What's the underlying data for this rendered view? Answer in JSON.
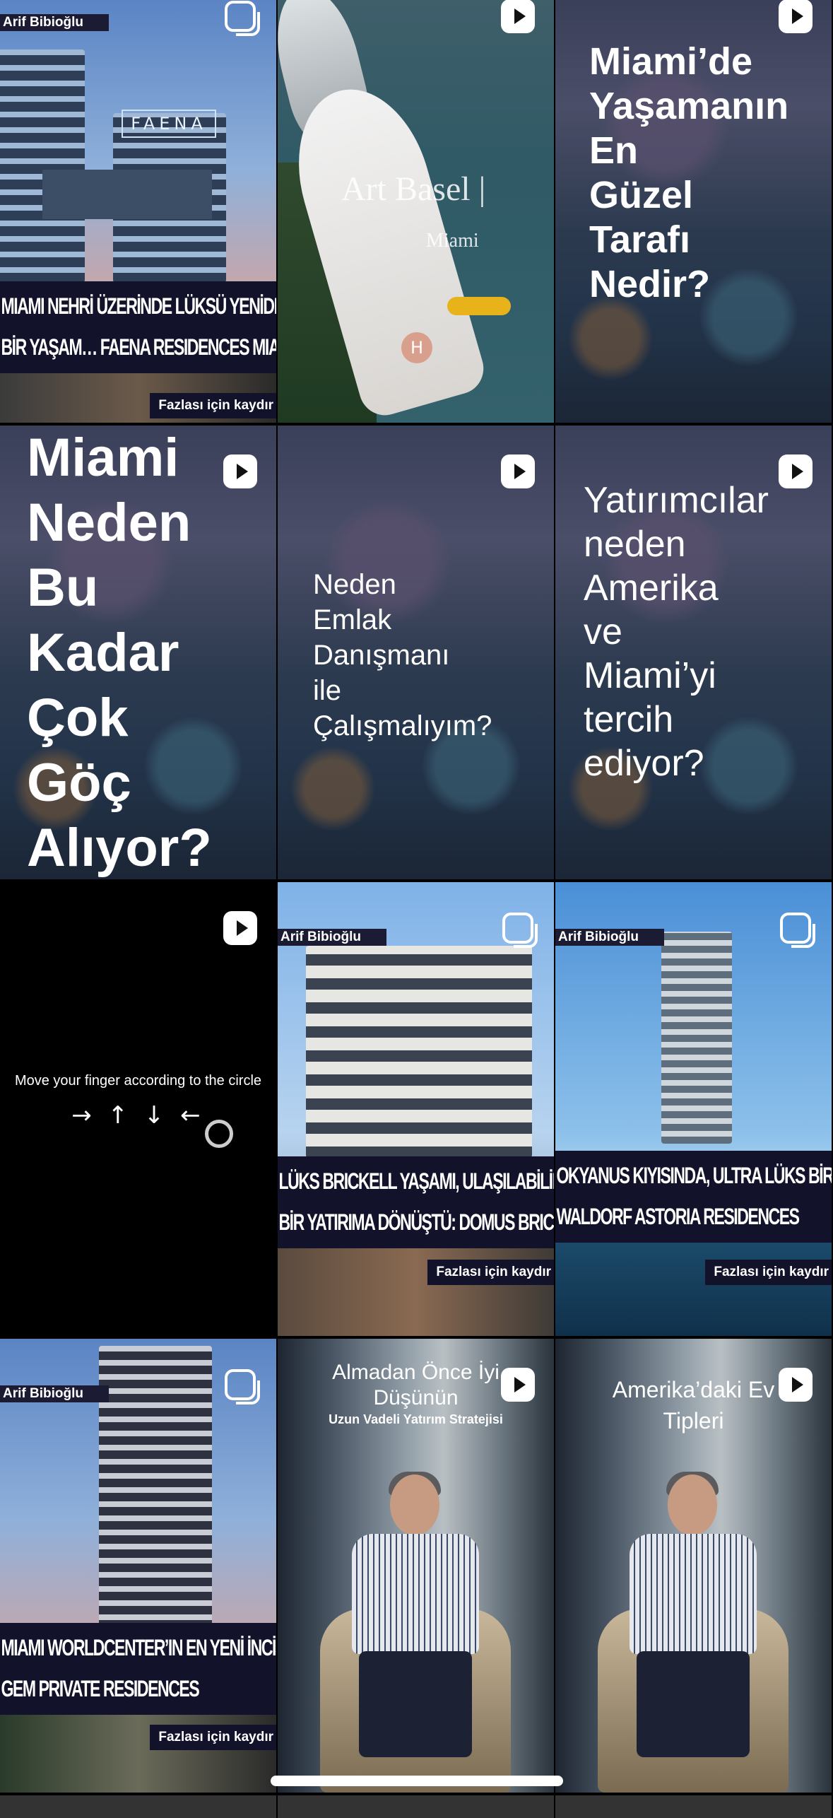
{
  "tiles": [
    {
      "type": "carousel",
      "name_tag": "Arif Bibioğlu",
      "sign": "FAENA",
      "banner_lines": [
        "MIAMI NEHRİ ÜZERİNDE LÜKSÜ YENİDEN TANIMLAYAN",
        "BİR YAŞAM… FAENA RESIDENCES MIAMI"
      ],
      "more": "Fazlası için kaydır"
    },
    {
      "type": "reel",
      "overlay_title": "Art Basel |",
      "overlay_sub": "Miami",
      "helipad": "H"
    },
    {
      "type": "reel",
      "lines": [
        "Miami’de",
        "Yaşamanın",
        "En",
        "Güzel",
        "Tarafı",
        "Nedir?"
      ]
    },
    {
      "type": "reel",
      "lines": [
        "Miami",
        "Neden",
        "Bu",
        "Kadar",
        "Çok",
        "Göç",
        "Alıyor?"
      ]
    },
    {
      "type": "reel",
      "lines": [
        "Neden",
        "Emlak",
        "Danışmanı",
        "ile",
        "Çalışmalıyım?"
      ]
    },
    {
      "type": "reel",
      "lines": [
        "Yatırımcılar",
        "neden",
        "Amerika",
        "ve",
        "Miami’yi",
        "tercih",
        "ediyor?"
      ]
    },
    {
      "type": "reel",
      "instruction": "Move your finger according to the circle",
      "arrows": "→ ↑ ↓ ←"
    },
    {
      "type": "carousel",
      "name_tag": "Arif Bibioğlu",
      "banner_lines": [
        "LÜKS BRICKELL YAŞAMI, ULAŞILABİLİR",
        "BİR YATIRIMA DÖNÜŞTÜ: DOMUS BRICKELL PARK"
      ],
      "more": "Fazlası için kaydır"
    },
    {
      "type": "carousel",
      "name_tag": "Arif Bibioğlu",
      "banner_lines": [
        "OKYANUS KIYISINDA, ULTRA LÜKS BİR YAŞAM",
        "WALDORF ASTORIA RESIDENCES"
      ],
      "more": "Fazlası için kaydır"
    },
    {
      "type": "carousel",
      "name_tag": "Arif Bibioğlu",
      "banner_lines": [
        "MIAMI WORLDCENTER’IN EN YENİ İNCİSİ:",
        "GEM PRIVATE RESIDENCES"
      ],
      "more": "Fazlası için kaydır"
    },
    {
      "type": "reel",
      "title_lines": [
        "Almadan Önce İyi",
        "Düşünün"
      ],
      "subtitle": "Uzun Vadeli Yatırım Stratejisi"
    },
    {
      "type": "reel",
      "title_lines": [
        "Amerika’daki Ev",
        "Tipleri"
      ]
    }
  ],
  "colors": {
    "banner": "#12122a",
    "text": "#ffffff"
  },
  "icons": {
    "reel": "play-icon",
    "carousel": "carousel-icon"
  }
}
